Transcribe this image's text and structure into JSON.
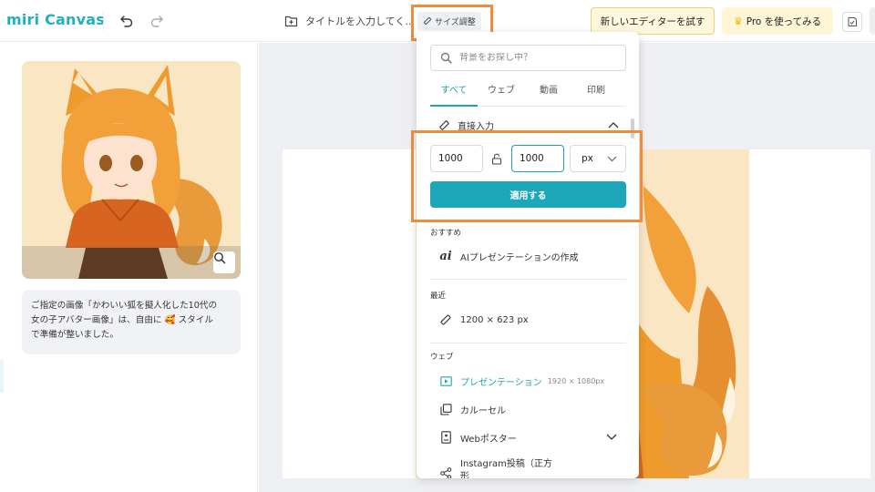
{
  "app": {
    "logo_text": "miri Canvas",
    "document_title": "タイトルを入力してく...",
    "size_button_label": "サイズ調整",
    "try_new_editor_label": "新しいエディターを試す",
    "pro_button_label": "Pro を使ってみる"
  },
  "left_panel": {
    "chat_lines": [
      "ご指定の画像「かわいい狐を擬人化した10代の",
      "女の子アバター画像」は、自由に 🥰 スタイル",
      "で準備が整いました。"
    ]
  },
  "size_panel": {
    "search_placeholder": "背景をお探し中？",
    "tabs": [
      "すべて",
      "ウェブ",
      "動画",
      "印刷"
    ],
    "active_tab": "すべて",
    "direct_input_label": "直接入力",
    "width_value": "1000",
    "height_value": "1000",
    "unit": "px",
    "apply_label": "適用する",
    "recommended_label": "おすすめ",
    "recommended_item": "AIプレゼンテーションの作成",
    "recent_label": "最近",
    "recent_item": "1200 × 623 px",
    "web_label": "ウェブ",
    "web_items": [
      {
        "label": "プレゼンテーション",
        "sub": "1920 × 1080px"
      },
      {
        "label": "カルーセル",
        "sub": ""
      },
      {
        "label": "Webポスター",
        "sub": ""
      },
      {
        "label": "Instagram投稿（正方",
        "sub": ""
      }
    ],
    "web_items_cont": "形"
  },
  "colors": {
    "accent": "#1ca8b8",
    "highlight": "#f28a3c",
    "pro_bg": "#fff6d6"
  }
}
